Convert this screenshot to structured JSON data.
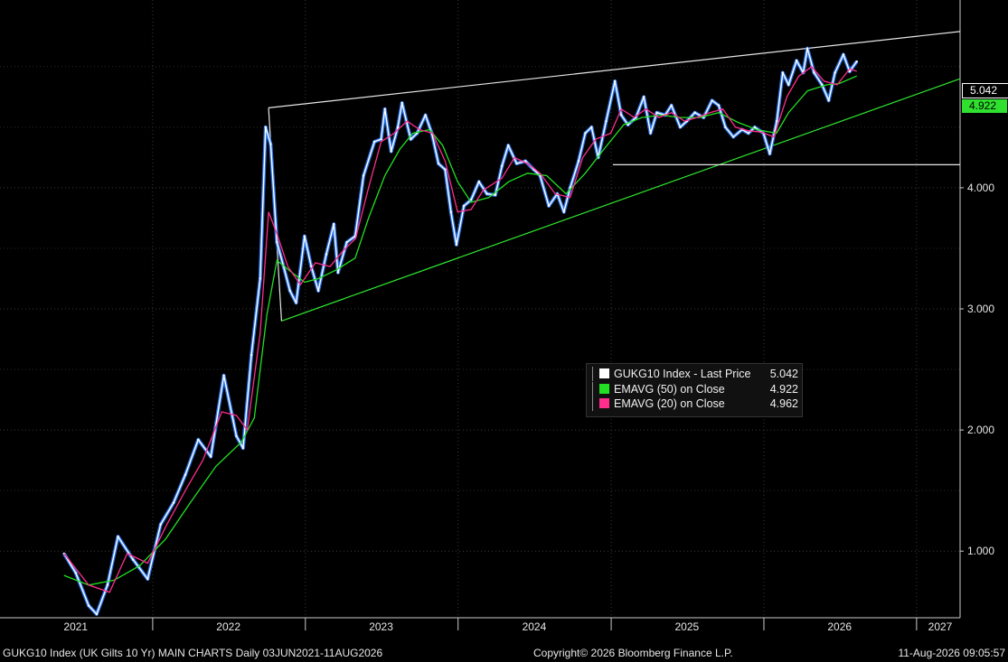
{
  "chart_data": {
    "type": "line",
    "ticker": "GUKG10 Index",
    "y_ticks": [
      "1.000",
      "2.000",
      "3.000",
      "4.000"
    ],
    "ylim": [
      0.45,
      5.55
    ],
    "x_ticks": [
      "2021",
      "2022",
      "2023",
      "2024",
      "2025",
      "2026",
      "2027"
    ],
    "xlim": [
      "2021-01-01",
      "2027-04-15"
    ],
    "grid": true,
    "legend_position": "center-right",
    "series": [
      {
        "name": "GUKG10 Index - Last Price",
        "legend_value": "5.042",
        "color": "#ffffff",
        "points": [
          [
            "2021-06-03",
            0.98
          ],
          [
            "2021-07-01",
            0.82
          ],
          [
            "2021-08-01",
            0.55
          ],
          [
            "2021-08-20",
            0.48
          ],
          [
            "2021-09-15",
            0.72
          ],
          [
            "2021-10-10",
            1.12
          ],
          [
            "2021-11-15",
            0.93
          ],
          [
            "2021-12-20",
            0.77
          ],
          [
            "2022-01-20",
            1.22
          ],
          [
            "2022-02-20",
            1.4
          ],
          [
            "2022-03-20",
            1.63
          ],
          [
            "2022-04-20",
            1.92
          ],
          [
            "2022-05-20",
            1.78
          ],
          [
            "2022-06-20",
            2.45
          ],
          [
            "2022-07-20",
            1.95
          ],
          [
            "2022-08-05",
            1.85
          ],
          [
            "2022-08-25",
            2.62
          ],
          [
            "2022-09-15",
            3.25
          ],
          [
            "2022-09-28",
            4.5
          ],
          [
            "2022-10-10",
            4.36
          ],
          [
            "2022-10-25",
            3.55
          ],
          [
            "2022-11-10",
            3.35
          ],
          [
            "2022-11-25",
            3.15
          ],
          [
            "2022-12-10",
            3.05
          ],
          [
            "2022-12-30",
            3.6
          ],
          [
            "2023-01-15",
            3.35
          ],
          [
            "2023-02-01",
            3.15
          ],
          [
            "2023-02-20",
            3.45
          ],
          [
            "2023-03-10",
            3.7
          ],
          [
            "2023-03-20",
            3.3
          ],
          [
            "2023-04-10",
            3.55
          ],
          [
            "2023-04-30",
            3.6
          ],
          [
            "2023-05-20",
            4.1
          ],
          [
            "2023-06-15",
            4.38
          ],
          [
            "2023-07-01",
            4.4
          ],
          [
            "2023-07-10",
            4.65
          ],
          [
            "2023-07-25",
            4.3
          ],
          [
            "2023-08-10",
            4.5
          ],
          [
            "2023-08-20",
            4.7
          ],
          [
            "2023-09-10",
            4.4
          ],
          [
            "2023-09-25",
            4.45
          ],
          [
            "2023-10-15",
            4.6
          ],
          [
            "2023-10-30",
            4.45
          ],
          [
            "2023-11-15",
            4.2
          ],
          [
            "2023-12-01",
            4.15
          ],
          [
            "2023-12-15",
            3.8
          ],
          [
            "2023-12-28",
            3.53
          ],
          [
            "2024-01-15",
            3.85
          ],
          [
            "2024-02-01",
            3.9
          ],
          [
            "2024-02-20",
            4.05
          ],
          [
            "2024-03-10",
            3.95
          ],
          [
            "2024-03-30",
            3.94
          ],
          [
            "2024-04-15",
            4.18
          ],
          [
            "2024-04-30",
            4.35
          ],
          [
            "2024-05-20",
            4.2
          ],
          [
            "2024-06-10",
            4.22
          ],
          [
            "2024-06-30",
            4.15
          ],
          [
            "2024-07-15",
            4.1
          ],
          [
            "2024-08-05",
            3.85
          ],
          [
            "2024-08-25",
            3.95
          ],
          [
            "2024-09-10",
            3.8
          ],
          [
            "2024-09-25",
            4.0
          ],
          [
            "2024-10-15",
            4.22
          ],
          [
            "2024-10-31",
            4.45
          ],
          [
            "2024-11-15",
            4.5
          ],
          [
            "2024-12-01",
            4.25
          ],
          [
            "2024-12-20",
            4.55
          ],
          [
            "2025-01-10",
            4.88
          ],
          [
            "2025-01-25",
            4.6
          ],
          [
            "2025-02-10",
            4.52
          ],
          [
            "2025-03-01",
            4.58
          ],
          [
            "2025-03-20",
            4.75
          ],
          [
            "2025-04-05",
            4.45
          ],
          [
            "2025-04-20",
            4.62
          ],
          [
            "2025-05-10",
            4.6
          ],
          [
            "2025-05-25",
            4.68
          ],
          [
            "2025-06-15",
            4.5
          ],
          [
            "2025-07-01",
            4.55
          ],
          [
            "2025-07-20",
            4.62
          ],
          [
            "2025-08-10",
            4.58
          ],
          [
            "2025-08-30",
            4.72
          ],
          [
            "2025-09-15",
            4.68
          ],
          [
            "2025-10-01",
            4.5
          ],
          [
            "2025-10-20",
            4.42
          ],
          [
            "2025-11-10",
            4.48
          ],
          [
            "2025-11-25",
            4.45
          ],
          [
            "2025-12-10",
            4.5
          ],
          [
            "2025-12-31",
            4.45
          ],
          [
            "2026-01-15",
            4.28
          ],
          [
            "2026-02-01",
            4.55
          ],
          [
            "2026-02-15",
            4.95
          ],
          [
            "2026-03-01",
            4.85
          ],
          [
            "2026-03-20",
            5.05
          ],
          [
            "2026-04-05",
            4.95
          ],
          [
            "2026-04-15",
            5.15
          ],
          [
            "2026-05-01",
            4.95
          ],
          [
            "2026-05-20",
            4.85
          ],
          [
            "2026-06-05",
            4.72
          ],
          [
            "2026-06-20",
            4.95
          ],
          [
            "2026-07-10",
            5.1
          ],
          [
            "2026-07-25",
            4.96
          ],
          [
            "2026-08-11",
            5.042
          ]
        ]
      },
      {
        "name": "EMAVG (20) on Close",
        "legend_value": "4.962",
        "color": "#ff2d8c",
        "points": [
          [
            "2021-06-03",
            0.98
          ],
          [
            "2021-08-01",
            0.72
          ],
          [
            "2021-09-20",
            0.66
          ],
          [
            "2021-11-01",
            0.98
          ],
          [
            "2021-12-20",
            0.9
          ],
          [
            "2022-02-01",
            1.2
          ],
          [
            "2022-03-20",
            1.5
          ],
          [
            "2022-05-01",
            1.75
          ],
          [
            "2022-06-15",
            2.15
          ],
          [
            "2022-07-20",
            2.12
          ],
          [
            "2022-08-15",
            2.0
          ],
          [
            "2022-09-15",
            2.8
          ],
          [
            "2022-10-05",
            3.8
          ],
          [
            "2022-10-25",
            3.62
          ],
          [
            "2022-11-20",
            3.35
          ],
          [
            "2022-12-20",
            3.2
          ],
          [
            "2023-01-25",
            3.38
          ],
          [
            "2023-03-01",
            3.35
          ],
          [
            "2023-04-01",
            3.48
          ],
          [
            "2023-05-01",
            3.58
          ],
          [
            "2023-06-01",
            4.0
          ],
          [
            "2023-07-01",
            4.38
          ],
          [
            "2023-08-01",
            4.45
          ],
          [
            "2023-09-01",
            4.55
          ],
          [
            "2023-10-01",
            4.48
          ],
          [
            "2023-11-01",
            4.45
          ],
          [
            "2023-12-01",
            4.22
          ],
          [
            "2023-12-31",
            3.8
          ],
          [
            "2024-02-01",
            3.82
          ],
          [
            "2024-03-01",
            3.98
          ],
          [
            "2024-04-15",
            4.08
          ],
          [
            "2024-05-15",
            4.25
          ],
          [
            "2024-06-15",
            4.2
          ],
          [
            "2024-07-15",
            4.12
          ],
          [
            "2024-08-20",
            3.95
          ],
          [
            "2024-09-25",
            3.92
          ],
          [
            "2024-10-25",
            4.25
          ],
          [
            "2024-11-25",
            4.4
          ],
          [
            "2024-12-31",
            4.45
          ],
          [
            "2025-01-25",
            4.65
          ],
          [
            "2025-02-25",
            4.58
          ],
          [
            "2025-03-25",
            4.65
          ],
          [
            "2025-04-25",
            4.58
          ],
          [
            "2025-05-25",
            4.62
          ],
          [
            "2025-06-25",
            4.55
          ],
          [
            "2025-07-25",
            4.58
          ],
          [
            "2025-08-25",
            4.62
          ],
          [
            "2025-09-25",
            4.65
          ],
          [
            "2025-10-25",
            4.5
          ],
          [
            "2025-11-25",
            4.47
          ],
          [
            "2025-12-25",
            4.46
          ],
          [
            "2026-01-25",
            4.42
          ],
          [
            "2026-02-25",
            4.75
          ],
          [
            "2026-03-25",
            4.92
          ],
          [
            "2026-04-25",
            5.0
          ],
          [
            "2026-05-25",
            4.88
          ],
          [
            "2026-06-25",
            4.85
          ],
          [
            "2026-07-25",
            4.98
          ],
          [
            "2026-08-11",
            4.962
          ]
        ]
      },
      {
        "name": "EMAVG (50) on Close",
        "legend_value": "4.922",
        "color": "#22e022",
        "points": [
          [
            "2021-06-03",
            0.8
          ],
          [
            "2021-08-01",
            0.72
          ],
          [
            "2021-10-01",
            0.76
          ],
          [
            "2021-12-01",
            0.88
          ],
          [
            "2022-02-01",
            1.1
          ],
          [
            "2022-04-01",
            1.4
          ],
          [
            "2022-06-01",
            1.7
          ],
          [
            "2022-08-01",
            1.9
          ],
          [
            "2022-09-01",
            2.1
          ],
          [
            "2022-10-01",
            2.95
          ],
          [
            "2022-10-25",
            3.4
          ],
          [
            "2022-11-30",
            3.3
          ],
          [
            "2022-12-30",
            3.22
          ],
          [
            "2023-02-01",
            3.25
          ],
          [
            "2023-03-15",
            3.32
          ],
          [
            "2023-04-30",
            3.42
          ],
          [
            "2023-06-01",
            3.75
          ],
          [
            "2023-07-10",
            4.1
          ],
          [
            "2023-08-15",
            4.32
          ],
          [
            "2023-09-15",
            4.45
          ],
          [
            "2023-10-25",
            4.48
          ],
          [
            "2023-11-25",
            4.35
          ],
          [
            "2023-12-31",
            4.05
          ],
          [
            "2024-02-01",
            3.88
          ],
          [
            "2024-03-15",
            3.92
          ],
          [
            "2024-05-01",
            4.05
          ],
          [
            "2024-06-15",
            4.12
          ],
          [
            "2024-07-31",
            4.1
          ],
          [
            "2024-09-15",
            3.95
          ],
          [
            "2024-10-31",
            4.12
          ],
          [
            "2024-12-15",
            4.32
          ],
          [
            "2025-01-31",
            4.52
          ],
          [
            "2025-03-15",
            4.58
          ],
          [
            "2025-04-30",
            4.6
          ],
          [
            "2025-06-15",
            4.58
          ],
          [
            "2025-07-31",
            4.58
          ],
          [
            "2025-09-15",
            4.62
          ],
          [
            "2025-10-31",
            4.54
          ],
          [
            "2025-12-15",
            4.48
          ],
          [
            "2026-01-31",
            4.45
          ],
          [
            "2026-03-01",
            4.62
          ],
          [
            "2026-04-15",
            4.8
          ],
          [
            "2026-05-31",
            4.85
          ],
          [
            "2026-06-30",
            4.86
          ],
          [
            "2026-08-11",
            4.922
          ]
        ]
      }
    ],
    "trendlines": [
      {
        "role": "upper-resistance",
        "color": "#e6e6e6",
        "from": [
          "2022-10-05",
          4.66
        ],
        "to": [
          "2027-04-15",
          5.29
        ]
      },
      {
        "role": "lower-support",
        "color": "#2ee82e",
        "from": [
          "2022-11-05",
          2.9
        ],
        "to": [
          "2027-04-15",
          4.9
        ]
      },
      {
        "role": "upper-bracket",
        "color": "#e6e6e6",
        "from": [
          "2022-10-05",
          4.66
        ],
        "to": [
          "2022-11-05",
          2.9
        ],
        "vertical_at_start": true
      },
      {
        "role": "horizontal-level",
        "color": "#e6e6e6",
        "from": [
          "2025-01-05",
          4.19
        ],
        "to": [
          "2027-04-15",
          4.19
        ]
      }
    ]
  },
  "price_tags": {
    "last": "5.042",
    "ema50": "4.922"
  },
  "legend": {
    "rows": [
      {
        "label": "GUKG10 Index - Last Price",
        "value": "5.042",
        "color": "#ffffff"
      },
      {
        "label": "EMAVG (50)  on Close",
        "value": "4.922",
        "color": "#22e022"
      },
      {
        "label": "EMAVG (20)  on Close",
        "value": "4.962",
        "color": "#ff2d8c"
      }
    ]
  },
  "footer": {
    "left": "GUKG10 Index (UK Gilts 10 Yr) MAIN CHARTS Daily 03JUN2021-11AUG2026",
    "center": "Copyright© 2026 Bloomberg Finance L.P.",
    "right": "11-Aug-2026 09:05:57"
  }
}
